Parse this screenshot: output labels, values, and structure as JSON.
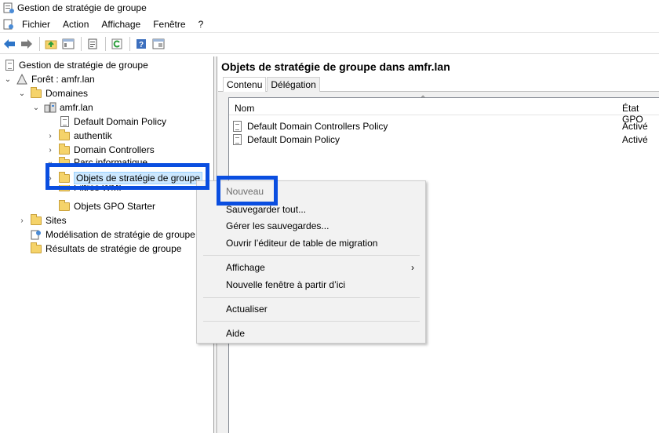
{
  "window": {
    "title": "Gestion de stratégie de groupe"
  },
  "menu": {
    "items": [
      "Fichier",
      "Action",
      "Affichage",
      "Fenêtre",
      "?"
    ]
  },
  "toolbar": {
    "icons": [
      "back-arrow-icon",
      "forward-arrow-icon",
      "up-folder-icon",
      "show-hide-tree-icon",
      "properties-icon",
      "refresh-icon",
      "help-icon",
      "console-icon"
    ]
  },
  "tree": {
    "root": "Gestion de stratégie de groupe",
    "forest": "Forêt : amfr.lan",
    "domains": "Domaines",
    "domain": "amfr.lan",
    "default_policy": "Default Domain Policy",
    "authentik": "authentik",
    "domain_controllers": "Domain Controllers",
    "parc": "Parc informatique",
    "gpo_objects": "Objets de stratégie de groupe",
    "wmi": "Filtres WMI",
    "starter": "Objets GPO Starter",
    "sites": "Sites",
    "modeling": "Modélisation de stratégie de groupe",
    "results": "Résultats de stratégie de groupe"
  },
  "right": {
    "title": "Objets de stratégie de groupe dans amfr.lan",
    "tabs": [
      "Contenu",
      "Délégation"
    ],
    "columns": {
      "name": "Nom",
      "status": "État GPO"
    },
    "rows": [
      {
        "name": "Default Domain Controllers Policy",
        "status": "Activé"
      },
      {
        "name": "Default Domain Policy",
        "status": "Activé"
      }
    ]
  },
  "context_menu": {
    "items": [
      {
        "label": "Nouveau"
      },
      {
        "label": "Sauvegarder tout..."
      },
      {
        "label": "Gérer les sauvegardes..."
      },
      {
        "label": "Ouvrir l’éditeur de table de migration"
      },
      {
        "label": "Affichage",
        "submenu_glyph": "›"
      },
      {
        "label": "Nouvelle fenêtre à partir d’ici"
      },
      {
        "label": "Actualiser"
      },
      {
        "label": "Aide"
      }
    ]
  },
  "colors": {
    "highlight_border": "#0a4ee0",
    "selection_bg": "#cce8ff"
  }
}
